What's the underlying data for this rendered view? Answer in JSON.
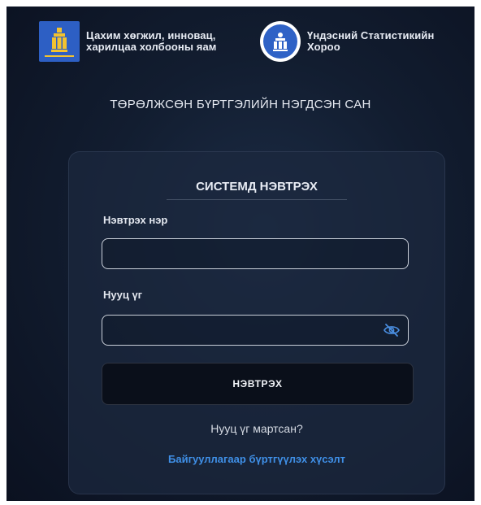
{
  "header": {
    "left_org": {
      "line1": "Цахим хөгжил, инновац,",
      "line2": "харилцаа холбооны яам"
    },
    "right_org": {
      "line1": "Үндэсний Статистикийн",
      "line2": "Хороо"
    },
    "system_title": "ТӨРӨЛЖСӨН БҮРТГЭЛИЙН НЭГДСЭН САН"
  },
  "login": {
    "title": "СИСТЕМД НЭВТРЭХ",
    "username_label": "Нэвтрэх нэр",
    "username_value": "",
    "password_label": "Нууц үг",
    "password_value": "",
    "password_toggle_icon": "eye-slash-icon",
    "submit_label": "НЭВТРЭХ",
    "forgot_password": "Нууц үг мартсан?",
    "register_request": "Байгууллагаар бүртгүүлэх хүсэлт"
  },
  "colors": {
    "background": "#121d30",
    "accent_link": "#3f8fe6",
    "emblem_blue": "#2d5fc4",
    "button_bg": "#0a0f1a"
  }
}
